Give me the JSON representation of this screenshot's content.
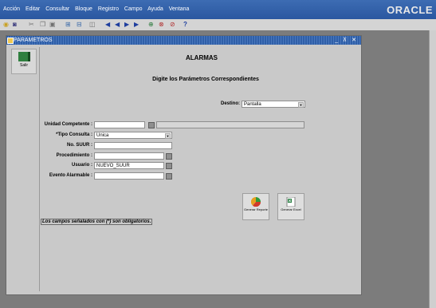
{
  "menubar": {
    "items": [
      "Acción",
      "Editar",
      "Consultar",
      "Bloque",
      "Registro",
      "Campo",
      "Ayuda",
      "Ventana"
    ],
    "brand": "ORACLE"
  },
  "toolbar": {
    "icons": [
      "open-icon",
      "print-icon",
      "cut-icon",
      "copy-icon",
      "paste-icon",
      "query-icon",
      "execute-icon",
      "first-icon",
      "prev-icon",
      "next-icon",
      "last-icon",
      "insert-icon",
      "delete-icon",
      "help-icon"
    ]
  },
  "window": {
    "title": "PARAMETROS",
    "controls": "_ ⊼ ✕"
  },
  "sidebar": {
    "salir_label": "Salir"
  },
  "header": {
    "title": "ALARMAS",
    "subtitle": "Digite los Parámetros Correspondientes"
  },
  "destino": {
    "label": "Destino:",
    "value": "Pantalla"
  },
  "form": {
    "unidad_label": "Unidad Competente :",
    "unidad_value": "",
    "unidad_desc": "",
    "tipo_label": "*Tipo Consulta :",
    "tipo_value": "Unica",
    "suur_label": "No. SUUR :",
    "suur_value": "",
    "proc_label": "Procedimiento :",
    "proc_value": "",
    "usuario_label": "Usuario :",
    "usuario_value": "NUEVO_SUUR",
    "evento_label": "Evento Alarmable :",
    "evento_value": ""
  },
  "actions": {
    "reporte_label": "Generar Reporte",
    "excel_label": "Generar Excel"
  },
  "note": "Los campos señalados con (*) son obligatorios.",
  "colors": {
    "titlebar": "#2f5fa8",
    "menubar": "#3d6cb3",
    "panel": "#c9c9c9"
  }
}
